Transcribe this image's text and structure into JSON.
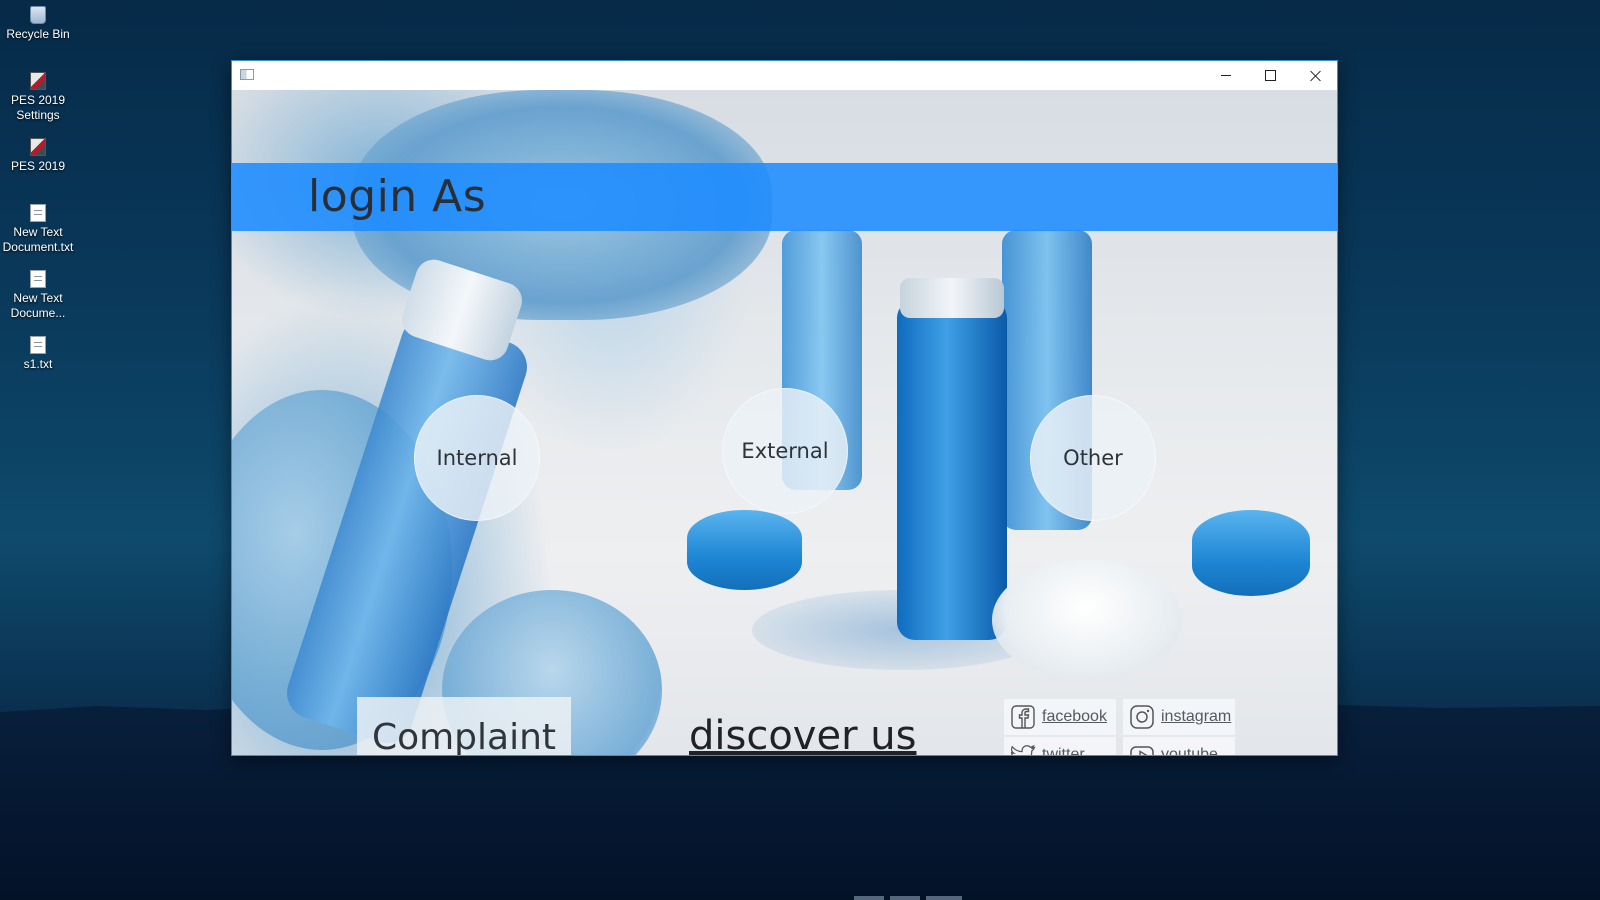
{
  "desktop": {
    "icons": [
      {
        "label": "Recycle Bin",
        "icon": "recycle-bin-icon"
      },
      {
        "label": "PES 2019 Settings",
        "icon": "app-icon"
      },
      {
        "label": "PES 2019",
        "icon": "app-icon"
      },
      {
        "label": "New Text Document.txt",
        "icon": "text-file-icon"
      },
      {
        "label": "New Text Docume...",
        "icon": "text-file-icon"
      },
      {
        "label": "s1.txt",
        "icon": "text-file-icon"
      }
    ]
  },
  "window": {
    "title": "",
    "header_title": "login As",
    "login_options": [
      "Internal",
      "External",
      "Other"
    ],
    "complaint_label": "Complaint",
    "discover_label": "discover us",
    "social": {
      "facebook": "facebook",
      "instagram": "instagram",
      "twitter": "twitter",
      "youtube": "youtube"
    },
    "colors": {
      "header_band": "#1e8cff",
      "window_border": "#3c8fd8"
    }
  }
}
